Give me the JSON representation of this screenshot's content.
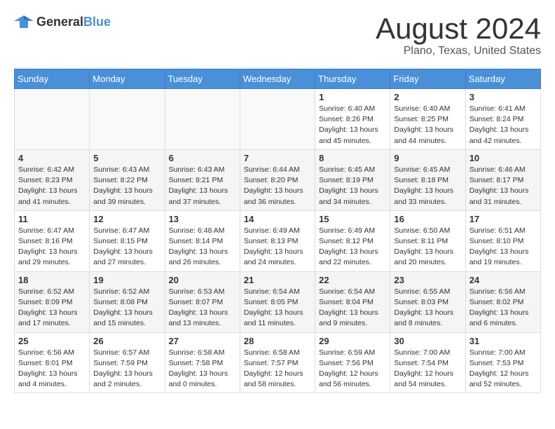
{
  "header": {
    "logo": {
      "general": "General",
      "blue": "Blue"
    },
    "title": "August 2024",
    "location": "Plano, Texas, United States"
  },
  "days_of_week": [
    "Sunday",
    "Monday",
    "Tuesday",
    "Wednesday",
    "Thursday",
    "Friday",
    "Saturday"
  ],
  "weeks": [
    [
      {
        "day": "",
        "empty": true
      },
      {
        "day": "",
        "empty": true
      },
      {
        "day": "",
        "empty": true
      },
      {
        "day": "",
        "empty": true
      },
      {
        "day": "1",
        "sunrise": "6:40 AM",
        "sunset": "8:26 PM",
        "daylight": "13 hours and 45 minutes."
      },
      {
        "day": "2",
        "sunrise": "6:40 AM",
        "sunset": "8:25 PM",
        "daylight": "13 hours and 44 minutes."
      },
      {
        "day": "3",
        "sunrise": "6:41 AM",
        "sunset": "8:24 PM",
        "daylight": "13 hours and 42 minutes."
      }
    ],
    [
      {
        "day": "4",
        "sunrise": "6:42 AM",
        "sunset": "8:23 PM",
        "daylight": "13 hours and 41 minutes."
      },
      {
        "day": "5",
        "sunrise": "6:43 AM",
        "sunset": "8:22 PM",
        "daylight": "13 hours and 39 minutes."
      },
      {
        "day": "6",
        "sunrise": "6:43 AM",
        "sunset": "8:21 PM",
        "daylight": "13 hours and 37 minutes."
      },
      {
        "day": "7",
        "sunrise": "6:44 AM",
        "sunset": "8:20 PM",
        "daylight": "13 hours and 36 minutes."
      },
      {
        "day": "8",
        "sunrise": "6:45 AM",
        "sunset": "8:19 PM",
        "daylight": "13 hours and 34 minutes."
      },
      {
        "day": "9",
        "sunrise": "6:45 AM",
        "sunset": "8:18 PM",
        "daylight": "13 hours and 33 minutes."
      },
      {
        "day": "10",
        "sunrise": "6:46 AM",
        "sunset": "8:17 PM",
        "daylight": "13 hours and 31 minutes."
      }
    ],
    [
      {
        "day": "11",
        "sunrise": "6:47 AM",
        "sunset": "8:16 PM",
        "daylight": "13 hours and 29 minutes."
      },
      {
        "day": "12",
        "sunrise": "6:47 AM",
        "sunset": "8:15 PM",
        "daylight": "13 hours and 27 minutes."
      },
      {
        "day": "13",
        "sunrise": "6:48 AM",
        "sunset": "8:14 PM",
        "daylight": "13 hours and 26 minutes."
      },
      {
        "day": "14",
        "sunrise": "6:49 AM",
        "sunset": "8:13 PM",
        "daylight": "13 hours and 24 minutes."
      },
      {
        "day": "15",
        "sunrise": "6:49 AM",
        "sunset": "8:12 PM",
        "daylight": "13 hours and 22 minutes."
      },
      {
        "day": "16",
        "sunrise": "6:50 AM",
        "sunset": "8:11 PM",
        "daylight": "13 hours and 20 minutes."
      },
      {
        "day": "17",
        "sunrise": "6:51 AM",
        "sunset": "8:10 PM",
        "daylight": "13 hours and 19 minutes."
      }
    ],
    [
      {
        "day": "18",
        "sunrise": "6:52 AM",
        "sunset": "8:09 PM",
        "daylight": "13 hours and 17 minutes."
      },
      {
        "day": "19",
        "sunrise": "6:52 AM",
        "sunset": "8:08 PM",
        "daylight": "13 hours and 15 minutes."
      },
      {
        "day": "20",
        "sunrise": "6:53 AM",
        "sunset": "8:07 PM",
        "daylight": "13 hours and 13 minutes."
      },
      {
        "day": "21",
        "sunrise": "6:54 AM",
        "sunset": "8:05 PM",
        "daylight": "13 hours and 11 minutes."
      },
      {
        "day": "22",
        "sunrise": "6:54 AM",
        "sunset": "8:04 PM",
        "daylight": "13 hours and 9 minutes."
      },
      {
        "day": "23",
        "sunrise": "6:55 AM",
        "sunset": "8:03 PM",
        "daylight": "13 hours and 8 minutes."
      },
      {
        "day": "24",
        "sunrise": "6:56 AM",
        "sunset": "8:02 PM",
        "daylight": "13 hours and 6 minutes."
      }
    ],
    [
      {
        "day": "25",
        "sunrise": "6:56 AM",
        "sunset": "8:01 PM",
        "daylight": "13 hours and 4 minutes."
      },
      {
        "day": "26",
        "sunrise": "6:57 AM",
        "sunset": "7:59 PM",
        "daylight": "13 hours and 2 minutes."
      },
      {
        "day": "27",
        "sunrise": "6:58 AM",
        "sunset": "7:58 PM",
        "daylight": "13 hours and 0 minutes."
      },
      {
        "day": "28",
        "sunrise": "6:58 AM",
        "sunset": "7:57 PM",
        "daylight": "12 hours and 58 minutes."
      },
      {
        "day": "29",
        "sunrise": "6:59 AM",
        "sunset": "7:56 PM",
        "daylight": "12 hours and 56 minutes."
      },
      {
        "day": "30",
        "sunrise": "7:00 AM",
        "sunset": "7:54 PM",
        "daylight": "12 hours and 54 minutes."
      },
      {
        "day": "31",
        "sunrise": "7:00 AM",
        "sunset": "7:53 PM",
        "daylight": "12 hours and 52 minutes."
      }
    ]
  ]
}
